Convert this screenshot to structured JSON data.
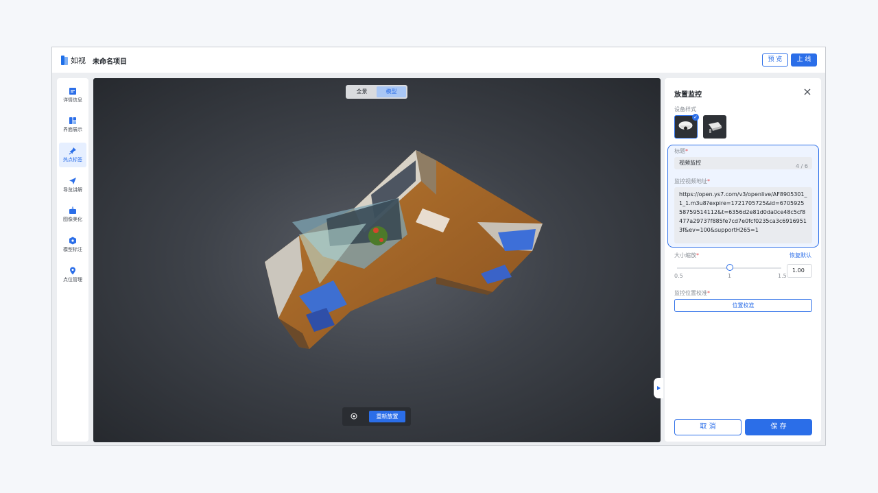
{
  "header": {
    "brand": "如视",
    "project_name": "未命名项目",
    "preview_label": "预 览",
    "online_label": "上 线"
  },
  "sidebar": {
    "items": [
      {
        "label": "详情信息",
        "icon": "document-icon"
      },
      {
        "label": "界面展示",
        "icon": "layout-icon"
      },
      {
        "label": "热点标签",
        "icon": "pin-icon",
        "active": true
      },
      {
        "label": "导览讲解",
        "icon": "navigate-icon"
      },
      {
        "label": "图像美化",
        "icon": "image-enhance-icon"
      },
      {
        "label": "模型标注",
        "icon": "model-mark-icon"
      },
      {
        "label": "点位管理",
        "icon": "location-icon"
      }
    ]
  },
  "viewport": {
    "view_tabs": [
      "全景",
      "模型"
    ],
    "active_view": "模型",
    "reset_label": "重新放置"
  },
  "panel": {
    "title": "放置监控",
    "device_style_label": "设备样式",
    "title_field_label": "标题",
    "title_value": "视频监控",
    "title_counter": "4 / 6",
    "url_label": "监控视频地址",
    "url_value": "https://open.ys7.com/v3/openlive/AF8905301_1_1.m3u8?expire=1721705725&id=670592558759514112&t=6356d2e81d0da0ce48c5cf8477a29737f885fe7cd7e0fcf0235ca3c69169513f&ev=100&supportH265=1",
    "scale_label": "大小缩放",
    "restore_default": "恢复默认",
    "scale_min": "0.5",
    "scale_mid": "1",
    "scale_max": "1.5",
    "scale_value": "1.00",
    "calibration_label": "监控位置校准",
    "calibration_button": "位置校准",
    "cancel_label": "取 消",
    "save_label": "保 存"
  },
  "colors": {
    "accent": "#2b6ee8",
    "required": "#e5484d"
  }
}
